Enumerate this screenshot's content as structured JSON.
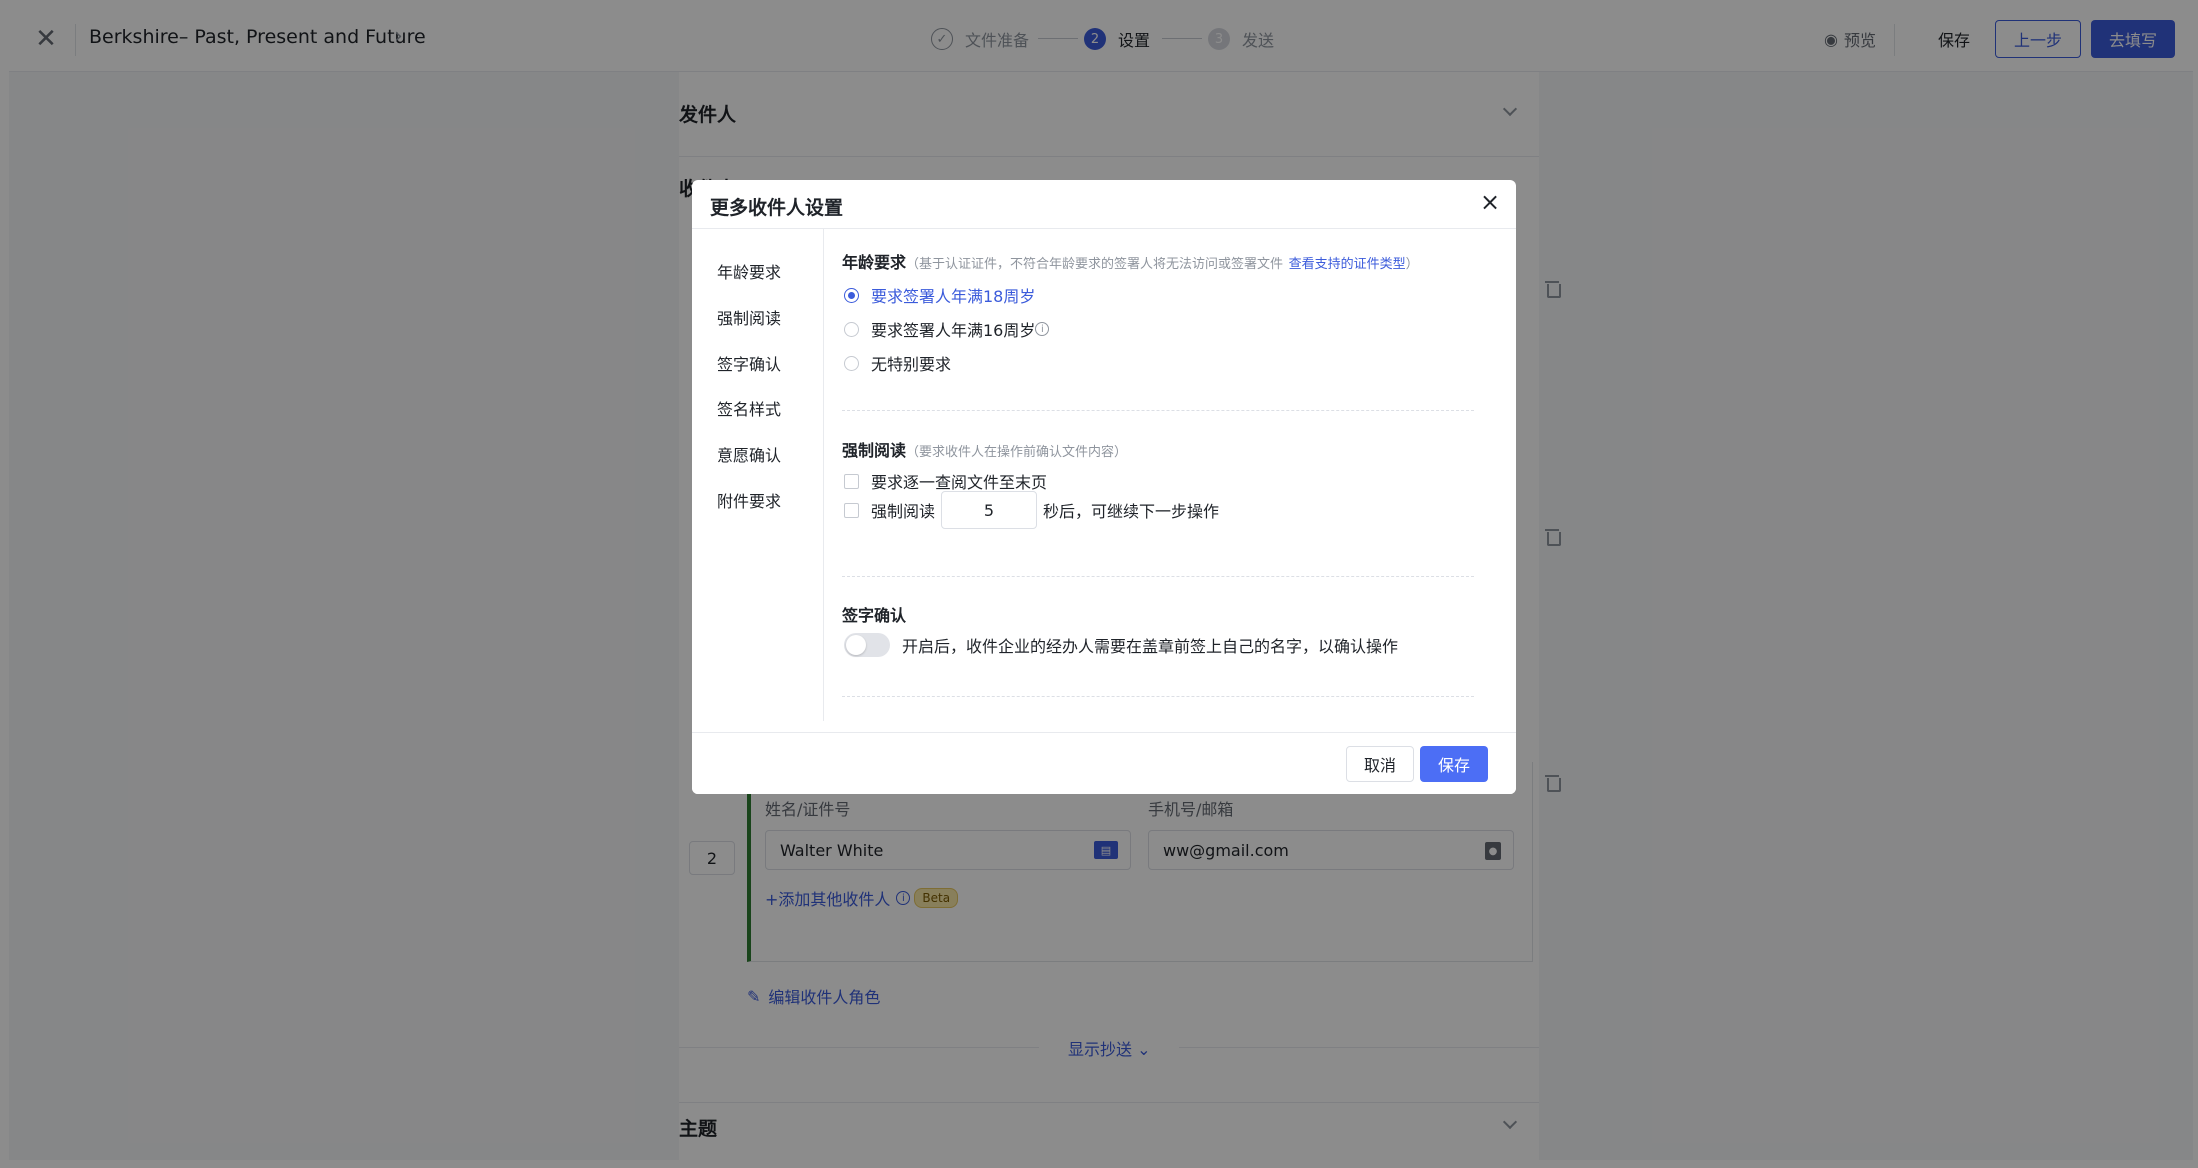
{
  "topbar": {
    "close_icon": "close-icon",
    "doc_title": "Berkshire– Past, Present and Future",
    "steps": [
      {
        "index": "✓",
        "label": "文件准备"
      },
      {
        "index": "2",
        "label": "设置"
      },
      {
        "index": "3",
        "label": "发送"
      }
    ],
    "preview_label": "预览",
    "save_label": "保存",
    "prev_label": "上一步",
    "next_label": "去填写"
  },
  "page": {
    "sender_title": "发件人",
    "recipient_title": "收件人",
    "recipient_number": "2",
    "name_label": "姓名/证件号",
    "name_value": "Walter White",
    "contact_label": "手机号/邮箱",
    "contact_value": "ww@gmail.com",
    "add_recipient": "+添加其他收件人",
    "beta_badge": "Beta",
    "edit_role": "编辑收件人角色",
    "show_cc": "显示抄送",
    "subject_title": "主题"
  },
  "modal": {
    "title": "更多收件人设置",
    "nav": [
      "年龄要求",
      "强制阅读",
      "签字确认",
      "签名样式",
      "意愿确认",
      "附件要求"
    ],
    "age": {
      "title": "年龄要求",
      "desc": "（基于认证证件，不符合年龄要求的签署人将无法访问或签署文件",
      "link": "查看支持的证件类型",
      "desc_end": "）",
      "options": [
        "要求签署人年满18周岁",
        "要求签署人年满16周岁",
        "无特别要求"
      ],
      "selected": 0
    },
    "read": {
      "title": "强制阅读",
      "desc": "（要求收件人在操作前确认文件内容）",
      "opt1": "要求逐一查阅文件至末页",
      "opt2_prefix": "强制阅读",
      "seconds": "5",
      "opt2_suffix": "秒后，可继续下一步操作"
    },
    "sign": {
      "title": "签字确认",
      "toggle_desc": "开启后，收件企业的经办人需要在盖章前签上自己的名字，以确认操作"
    },
    "cancel_label": "取消",
    "save_label": "保存"
  },
  "colors": {
    "primary": "#3b5bdb",
    "accent_bar": "#2e7d32",
    "beta_bg": "#f8e7a6"
  }
}
